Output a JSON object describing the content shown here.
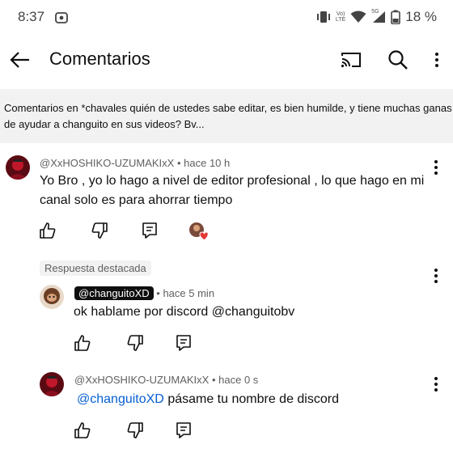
{
  "status": {
    "time": "8:37",
    "battery": "18 %",
    "net_small_top": "Vo)",
    "net_small_bottom": "LTE",
    "signal_label": "5G"
  },
  "header": {
    "title": "Comentarios"
  },
  "context": {
    "text": "Comentarios en *chavales quién de ustedes sabe editar, es bien humilde, y tiene muchas ganas de ayudar a changuito en sus videos? Bv..."
  },
  "comments": [
    {
      "author": "@XxHOSHIKO-UZUMAKIxX",
      "separator": "•",
      "time": "hace 10 h",
      "text": "Yo Bro , yo lo hago a nivel de editor profesional , lo que hago en mi canal solo es para ahorrar tiempo"
    },
    {
      "pinned_label": "Respuesta destacada",
      "author": "@changuitoXD",
      "separator": "•",
      "time": "hace 5 min",
      "text": "ok hablame por discord @changuitobv"
    },
    {
      "author": "@XxHOSHIKO-UZUMAKIxX",
      "separator": "•",
      "time": "hace 0 s",
      "mention": "@changuitoXD",
      "text": "pásame tu nombre de discord"
    }
  ],
  "icons": {
    "back": "arrow-left-icon",
    "cast": "cast-icon",
    "search": "search-icon",
    "more": "more-vertical-icon",
    "like": "thumb-up-icon",
    "dislike": "thumb-down-icon",
    "reply": "reply-icon",
    "heart": "creator-heart-icon"
  },
  "colors": {
    "mention": "#065fd4",
    "heart": "#e53935",
    "context_bg": "#f2f2f2"
  }
}
